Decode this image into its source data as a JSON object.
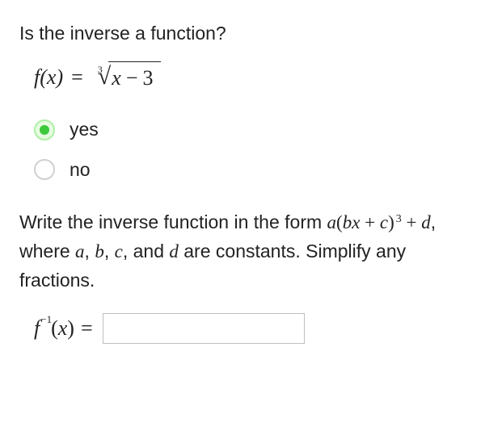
{
  "question1": {
    "prompt": "Is the inverse a function?"
  },
  "formula": {
    "lhs_fn": "f",
    "lhs_open": "(",
    "lhs_var": "x",
    "lhs_close": ")",
    "eq": "=",
    "root_index": "3",
    "radicand_var": "x",
    "radicand_op": "−",
    "radicand_const": "3"
  },
  "options": {
    "yes": {
      "label": "yes",
      "selected": true
    },
    "no": {
      "label": "no",
      "selected": false
    }
  },
  "question2": {
    "line_pre": "Write the inverse function in the form ",
    "form_a": "a",
    "form_open": "(",
    "form_b": "b",
    "form_x": "x",
    "form_plus": " + ",
    "form_c": "c",
    "form_close": ")",
    "form_exp": "3",
    "form_plus2": " + ",
    "form_d": "d",
    "line_post1": ", where ",
    "const_a": "a",
    "sep1": ", ",
    "const_b": "b",
    "sep2": ", ",
    "const_c": "c",
    "sep3": ", and ",
    "const_d": "d",
    "line_post2": " are constants. Simplify any fractions."
  },
  "answer": {
    "fn": "f",
    "exp": "−1",
    "open": "(",
    "var": "x",
    "close": ")",
    "eq": "=",
    "value": ""
  }
}
